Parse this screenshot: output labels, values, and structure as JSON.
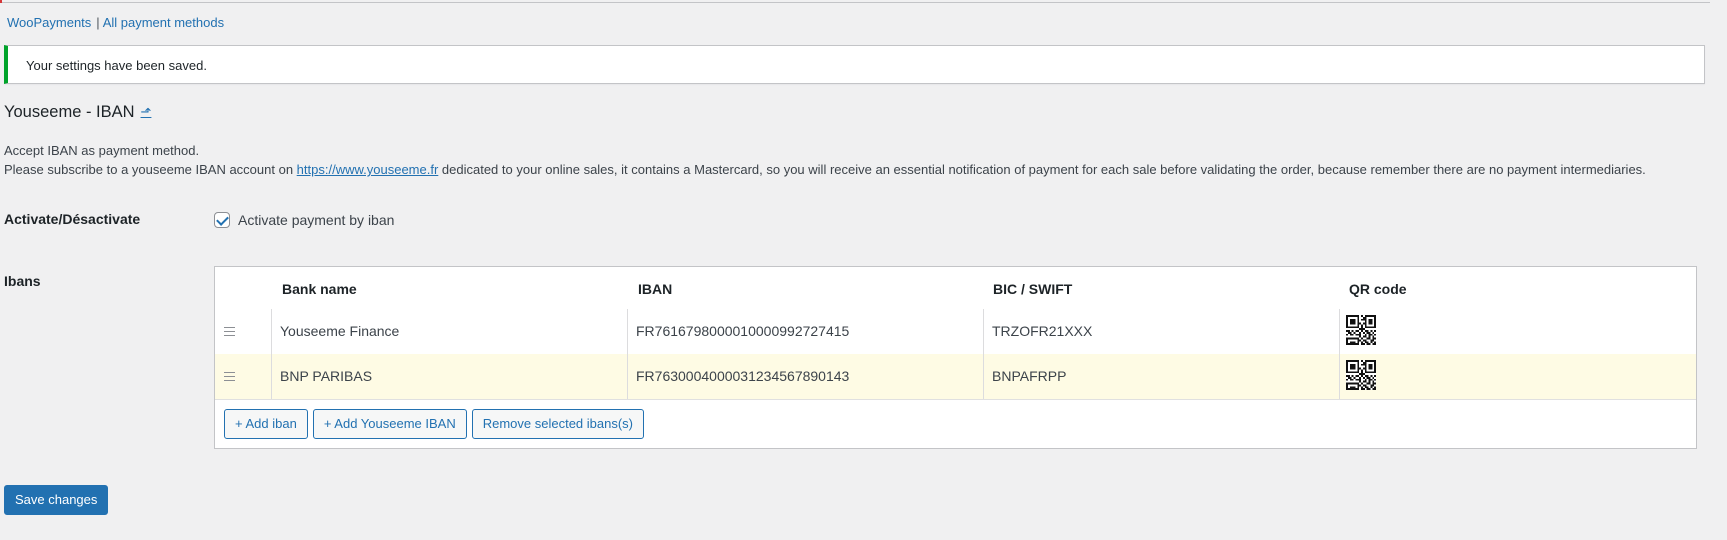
{
  "breadcrumb": {
    "items": [
      "WooPayments",
      "All payment methods"
    ],
    "separator": "|"
  },
  "notice": {
    "text": "Your settings have been saved."
  },
  "page": {
    "title": "Youseeme - IBAN",
    "title_link_icon": "⬏",
    "description_line1": "Accept IBAN as payment method.",
    "description_line2_before": "Please subscribe to a youseeme IBAN account on ",
    "description_link": "https://www.youseeme.fr",
    "description_line2_after": " dedicated to your online sales, it contains a Mastercard, so you will receive an essential notification of payment for each sale before validating the order, because remember there are no payment intermediaries."
  },
  "activate": {
    "label": "Activate/Désactivate",
    "checkbox_label": "Activate payment by iban",
    "checked": true
  },
  "ibans": {
    "label": "Ibans",
    "columns": [
      "Bank name",
      "IBAN",
      "BIC / SWIFT",
      "QR code"
    ],
    "rows": [
      {
        "bank": "Youseeme Finance",
        "iban": "FR7616798000010000992727415",
        "bic": "TRZOFR21XXX",
        "qr": "qr-code-icon"
      },
      {
        "bank": "BNP PARIBAS",
        "iban": "FR7630004000031234567890143",
        "bic": "BNPAFRPP",
        "qr": "qr-code-icon"
      }
    ],
    "buttons": {
      "add": "+ Add iban",
      "add_youseeme": "+ Add Youseeme IBAN",
      "remove": "Remove selected ibans(s)"
    }
  },
  "save_button": "Save changes",
  "colors": {
    "accent": "#2271b1",
    "notice_success": "#00a32a",
    "selected_row": "#fefbe4"
  }
}
